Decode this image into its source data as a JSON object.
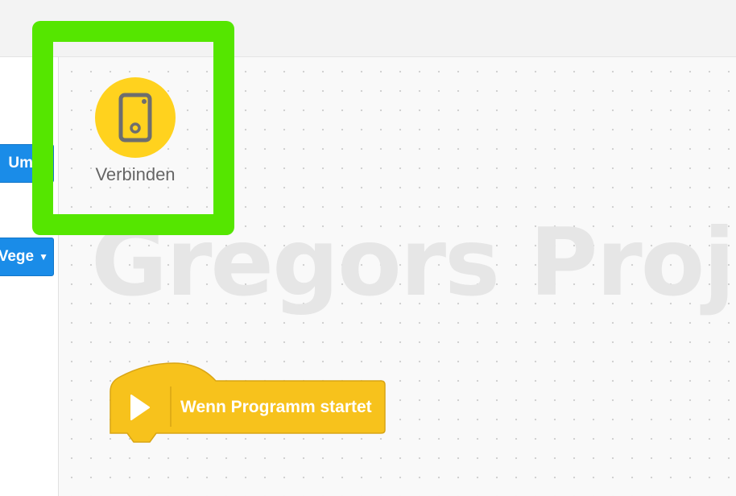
{
  "palette": {
    "blocks": [
      {
        "label": "Umdr"
      },
      {
        "label": "Vege",
        "has_dropdown": true
      }
    ]
  },
  "canvas": {
    "watermark": "Gregors Proj"
  },
  "connect": {
    "label": "Verbinden",
    "icon": "phone-icon",
    "color": "#ffd21e"
  },
  "start_block": {
    "label": "Wenn Programm startet",
    "icon": "play-icon",
    "color": "#f7c21c"
  },
  "highlight": {
    "color": "#55e600"
  }
}
